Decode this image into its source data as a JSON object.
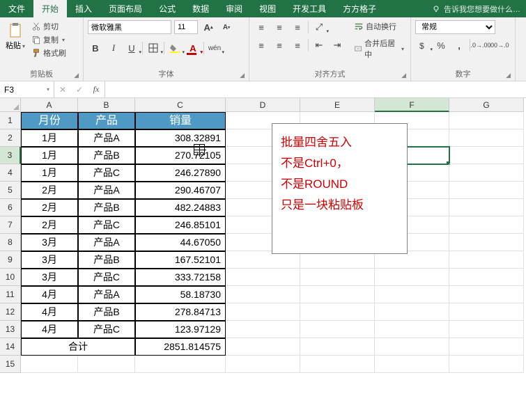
{
  "menubar": {
    "tabs": [
      "文件",
      "开始",
      "插入",
      "页面布局",
      "公式",
      "数据",
      "审阅",
      "视图",
      "开发工具",
      "方方格子"
    ],
    "active_index": 1,
    "tellme": "告诉我您想要做什么…"
  },
  "ribbon": {
    "clipboard": {
      "label": "剪贴板",
      "paste": "粘贴",
      "cut": "剪切",
      "copy": "复制",
      "format_painter": "格式刷"
    },
    "font": {
      "label": "字体",
      "name": "微软雅黑",
      "size": "11",
      "grow": "A",
      "shrink": "A"
    },
    "align": {
      "label": "对齐方式",
      "wrap": "自动换行",
      "merge": "合并后居中"
    },
    "number": {
      "label": "数字",
      "format": "常规"
    }
  },
  "fxbar": {
    "namebox": "F3",
    "fx": "fx",
    "formula": ""
  },
  "columns": [
    "A",
    "B",
    "C",
    "D",
    "E",
    "F",
    "G"
  ],
  "selected_col": "F",
  "selected_row": 3,
  "table": {
    "headers": [
      "月份",
      "产品",
      "销量"
    ],
    "rows": [
      [
        "1月",
        "产品A",
        "308.32891"
      ],
      [
        "1月",
        "产品B",
        "270.72105"
      ],
      [
        "1月",
        "产品C",
        "246.27890"
      ],
      [
        "2月",
        "产品A",
        "290.46707"
      ],
      [
        "2月",
        "产品B",
        "482.24883"
      ],
      [
        "2月",
        "产品C",
        "246.85101"
      ],
      [
        "3月",
        "产品A",
        "44.67050"
      ],
      [
        "3月",
        "产品B",
        "167.52101"
      ],
      [
        "3月",
        "产品C",
        "333.72158"
      ],
      [
        "4月",
        "产品A",
        "58.18730"
      ],
      [
        "4月",
        "产品B",
        "278.84713"
      ],
      [
        "4月",
        "产品C",
        "123.97129"
      ]
    ],
    "total_label": "合计",
    "total_value": "2851.814575"
  },
  "annotation": [
    "批量四舍五入",
    "不是Ctrl+0，",
    "不是ROUND",
    "只是一块粘贴板"
  ]
}
